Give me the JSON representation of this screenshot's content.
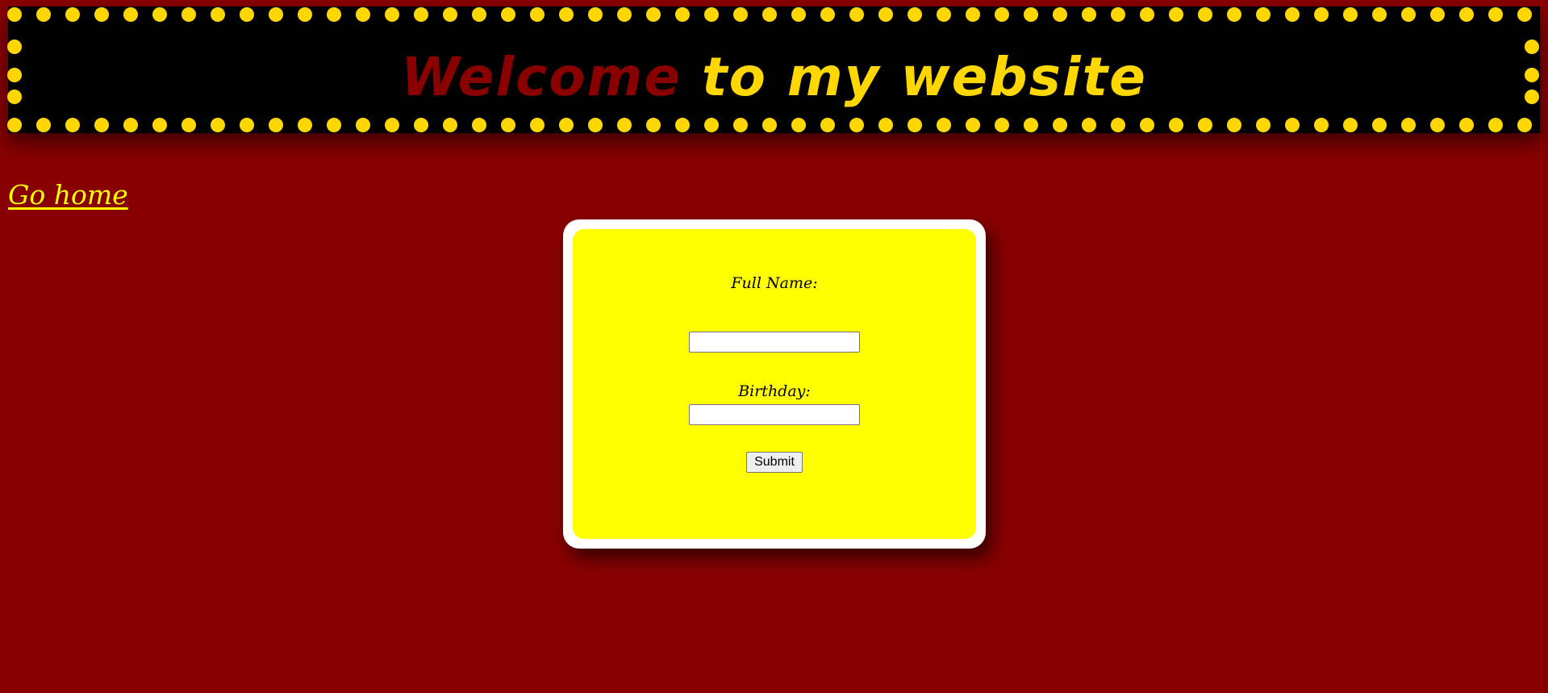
{
  "header": {
    "title_highlight": "Welcome",
    "title_rest": " to my website"
  },
  "nav": {
    "home_link": "Go home"
  },
  "form": {
    "name_label": "Full Name:",
    "name_value": "",
    "birthday_label": "Birthday:",
    "birthday_value": "",
    "submit_label": "Submit"
  },
  "colors": {
    "page_background": "#880000",
    "marquee_background": "#000000",
    "bulb": "#ffd700",
    "title_highlight": "#880000",
    "title_rest": "#ffd700",
    "link": "#ffff00",
    "form_frame": "#ffffff",
    "form_panel": "#ffff00"
  }
}
